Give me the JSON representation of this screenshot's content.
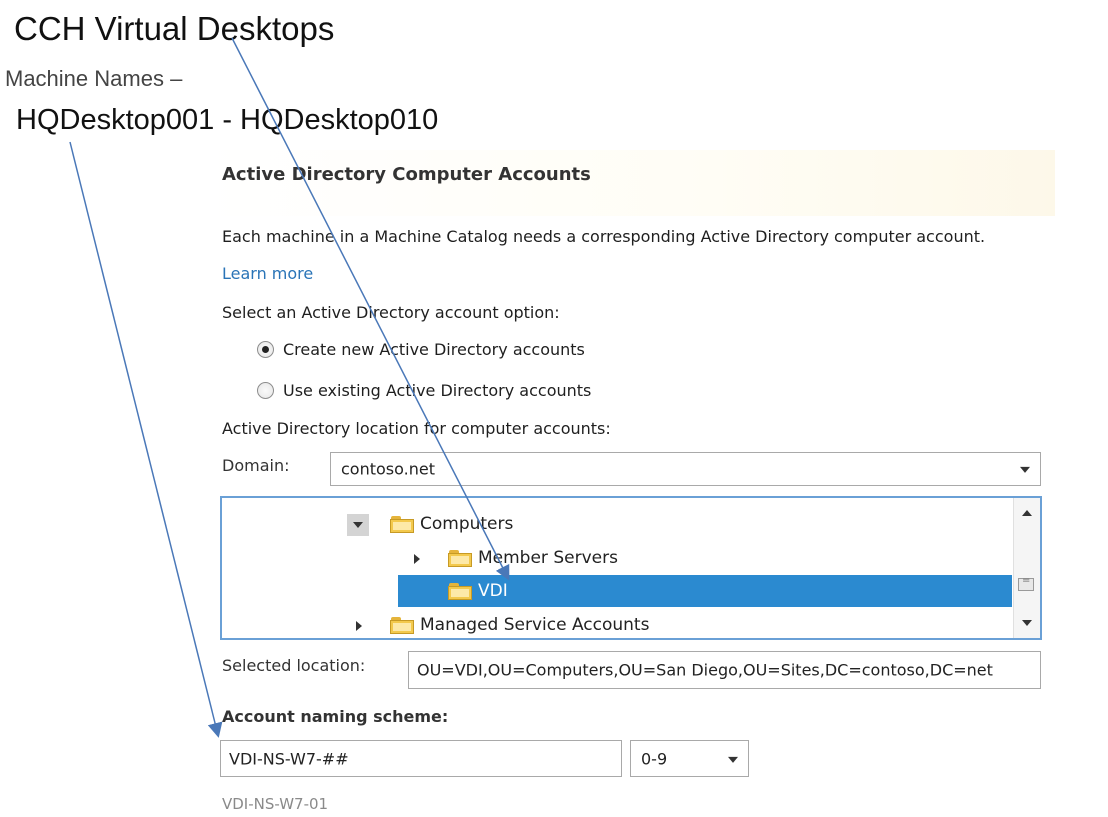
{
  "slide": {
    "title": "CCH Virtual Desktops",
    "machine_names_label": "Machine Names –",
    "machine_range": "HQDesktop001 - HQDesktop010"
  },
  "dialog": {
    "section_title": "Active Directory Computer Accounts",
    "description": "Each machine in a Machine Catalog needs a corresponding Active Directory computer account.",
    "learn_more": "Learn more",
    "option_prompt": "Select an Active Directory account option:",
    "options": [
      {
        "label": "Create new Active Directory accounts",
        "selected": true
      },
      {
        "label": "Use existing Active Directory accounts",
        "selected": false
      }
    ],
    "location_heading": "Active Directory location for computer accounts:",
    "domain_label": "Domain:",
    "domain_value": "contoso.net",
    "tree": [
      {
        "label": "Computers",
        "expanded": true,
        "selected": false
      },
      {
        "label": "Member Servers",
        "expanded": false,
        "selected": false
      },
      {
        "label": "VDI",
        "selected": true
      },
      {
        "label": "Managed Service Accounts",
        "expanded": false,
        "selected": false
      }
    ],
    "selected_location_label": "Selected location:",
    "selected_location_value": "OU=VDI,OU=Computers,OU=San Diego,OU=Sites,DC=contoso,DC=net",
    "naming_label": "Account naming scheme:",
    "naming_value": "VDI-NS-W7-##",
    "naming_type": "0-9",
    "naming_preview": "VDI-NS-W7-01"
  },
  "colors": {
    "selection": "#2b8ad0",
    "link": "#2a74b7",
    "arrow": "#4a78b8"
  },
  "icons": [
    "folder-icon",
    "expand-arrow-icon",
    "collapse-arrow-icon",
    "dropdown-arrow-icon",
    "scroll-up-icon",
    "scroll-down-icon"
  ]
}
